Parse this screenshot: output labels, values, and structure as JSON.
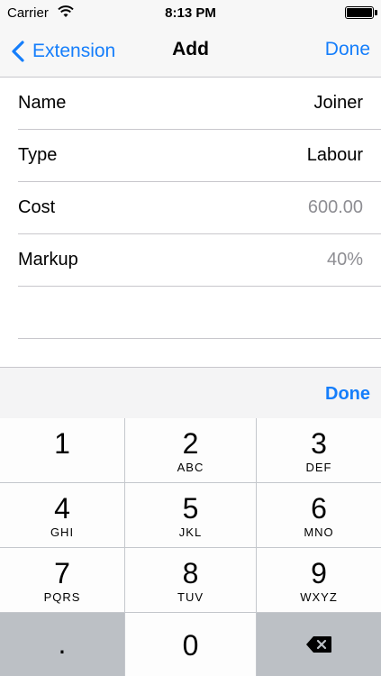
{
  "status_bar": {
    "carrier": "Carrier",
    "time": "8:13 PM",
    "icons": [
      "wifi-icon",
      "battery-icon"
    ]
  },
  "nav": {
    "back_label": "Extension",
    "title": "Add",
    "done_label": "Done",
    "accent_color": "#157efb"
  },
  "form": {
    "rows": [
      {
        "label": "Name",
        "value": "Joiner",
        "placeholder": false
      },
      {
        "label": "Type",
        "value": "Labour",
        "placeholder": false
      },
      {
        "label": "Cost",
        "value": "600.00",
        "placeholder": true
      },
      {
        "label": "Markup",
        "value": "40%",
        "placeholder": true
      }
    ]
  },
  "keyboard": {
    "accessory_done": "Done",
    "keys": [
      {
        "num": "1",
        "letters": ""
      },
      {
        "num": "2",
        "letters": "ABC"
      },
      {
        "num": "3",
        "letters": "DEF"
      },
      {
        "num": "4",
        "letters": "GHI"
      },
      {
        "num": "5",
        "letters": "JKL"
      },
      {
        "num": "6",
        "letters": "MNO"
      },
      {
        "num": "7",
        "letters": "PQRS"
      },
      {
        "num": "8",
        "letters": "TUV"
      },
      {
        "num": "9",
        "letters": "WXYZ"
      }
    ],
    "decimal": ".",
    "zero": "0",
    "delete_icon": "delete-backspace-icon"
  }
}
